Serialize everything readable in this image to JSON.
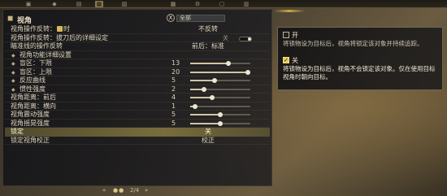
{
  "tabs": [
    "▣",
    "◆",
    "▤",
    "▦",
    "▨",
    "▩",
    "⚙",
    "▢",
    "▥"
  ],
  "active_tab": 3,
  "header": {
    "title": "视角",
    "filter_button": "X",
    "filter_value": "全部"
  },
  "rows": [
    {
      "label": "视角操作反转：",
      "label_suffix": "时",
      "value": "不反转",
      "type": "text"
    },
    {
      "label": "视角操作反转：拔刀后的详细设定",
      "value": "关",
      "type": "toggle"
    },
    {
      "label": "瞄准线的操作反转",
      "value": "前后：标准",
      "type": "text"
    },
    {
      "label": "视角功能详细设置",
      "type": "group"
    },
    {
      "label": "盲区：下限",
      "value": "13",
      "level": 0.65,
      "type": "slider-sub"
    },
    {
      "label": "盲区：上限",
      "value": "20",
      "level": 1.0,
      "type": "slider-sub"
    },
    {
      "label": "反应曲线",
      "value": "5",
      "level": 0.4,
      "type": "slider-sub"
    },
    {
      "label": "惯性强度",
      "value": "2",
      "level": 0.2,
      "type": "slider-sub"
    },
    {
      "label": "视角距离：前后",
      "value": "4",
      "level": 0.35,
      "type": "slider"
    },
    {
      "label": "视角距离：横向",
      "value": "1",
      "level": 0.05,
      "type": "slider"
    },
    {
      "label": "视角震动强度",
      "value": "5",
      "level": 0.5,
      "type": "slider"
    },
    {
      "label": "视角摇晃强度",
      "value": "5",
      "level": 0.5,
      "type": "slider"
    },
    {
      "label": "锁定",
      "value": "关",
      "type": "highlight"
    },
    {
      "label": "锁定视角校正",
      "value": "校正",
      "type": "text"
    }
  ],
  "pager": {
    "left": "«",
    "right": "»",
    "dots": "●●",
    "page": "2/4"
  },
  "description": {
    "options": [
      {
        "name": "开",
        "checked": false,
        "text": "将锁物设为目标后，视角将锁定该对象并持续追踪。"
      },
      {
        "name": "关",
        "checked": true,
        "text": "将锁物设为目标后，视角不会锁定该对象。仅在使用目标视角时朝向目标。"
      }
    ]
  },
  "colors": {
    "accent": "#e8cf5b",
    "highlight_row": "#8f8546"
  }
}
